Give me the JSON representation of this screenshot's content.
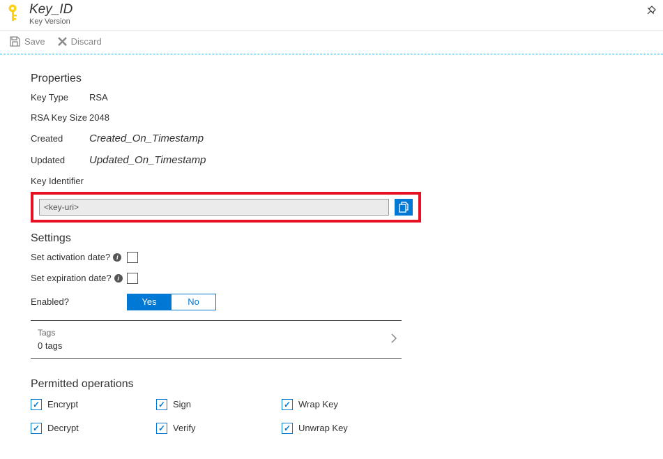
{
  "header": {
    "title": "Key_ID",
    "subtitle": "Key Version"
  },
  "toolbar": {
    "save_label": "Save",
    "discard_label": "Discard"
  },
  "properties": {
    "section_title": "Properties",
    "key_type_label": "Key Type",
    "key_type_value": "RSA",
    "rsa_size_label": "RSA Key Size",
    "rsa_size_value": "2048",
    "created_label": "Created",
    "created_value": "Created_On_Timestamp",
    "updated_label": "Updated",
    "updated_value": "Updated_On_Timestamp",
    "key_identifier_label": "Key Identifier",
    "key_uri_value": "<key-uri>"
  },
  "settings": {
    "section_title": "Settings",
    "activation_label": "Set activation date?",
    "expiration_label": "Set expiration date?",
    "enabled_label": "Enabled?",
    "yes_label": "Yes",
    "no_label": "No"
  },
  "tags": {
    "label": "Tags",
    "count_text": "0 tags"
  },
  "operations": {
    "section_title": "Permitted operations",
    "encrypt": "Encrypt",
    "sign": "Sign",
    "wrap": "Wrap Key",
    "decrypt": "Decrypt",
    "verify": "Verify",
    "unwrap": "Unwrap Key"
  }
}
